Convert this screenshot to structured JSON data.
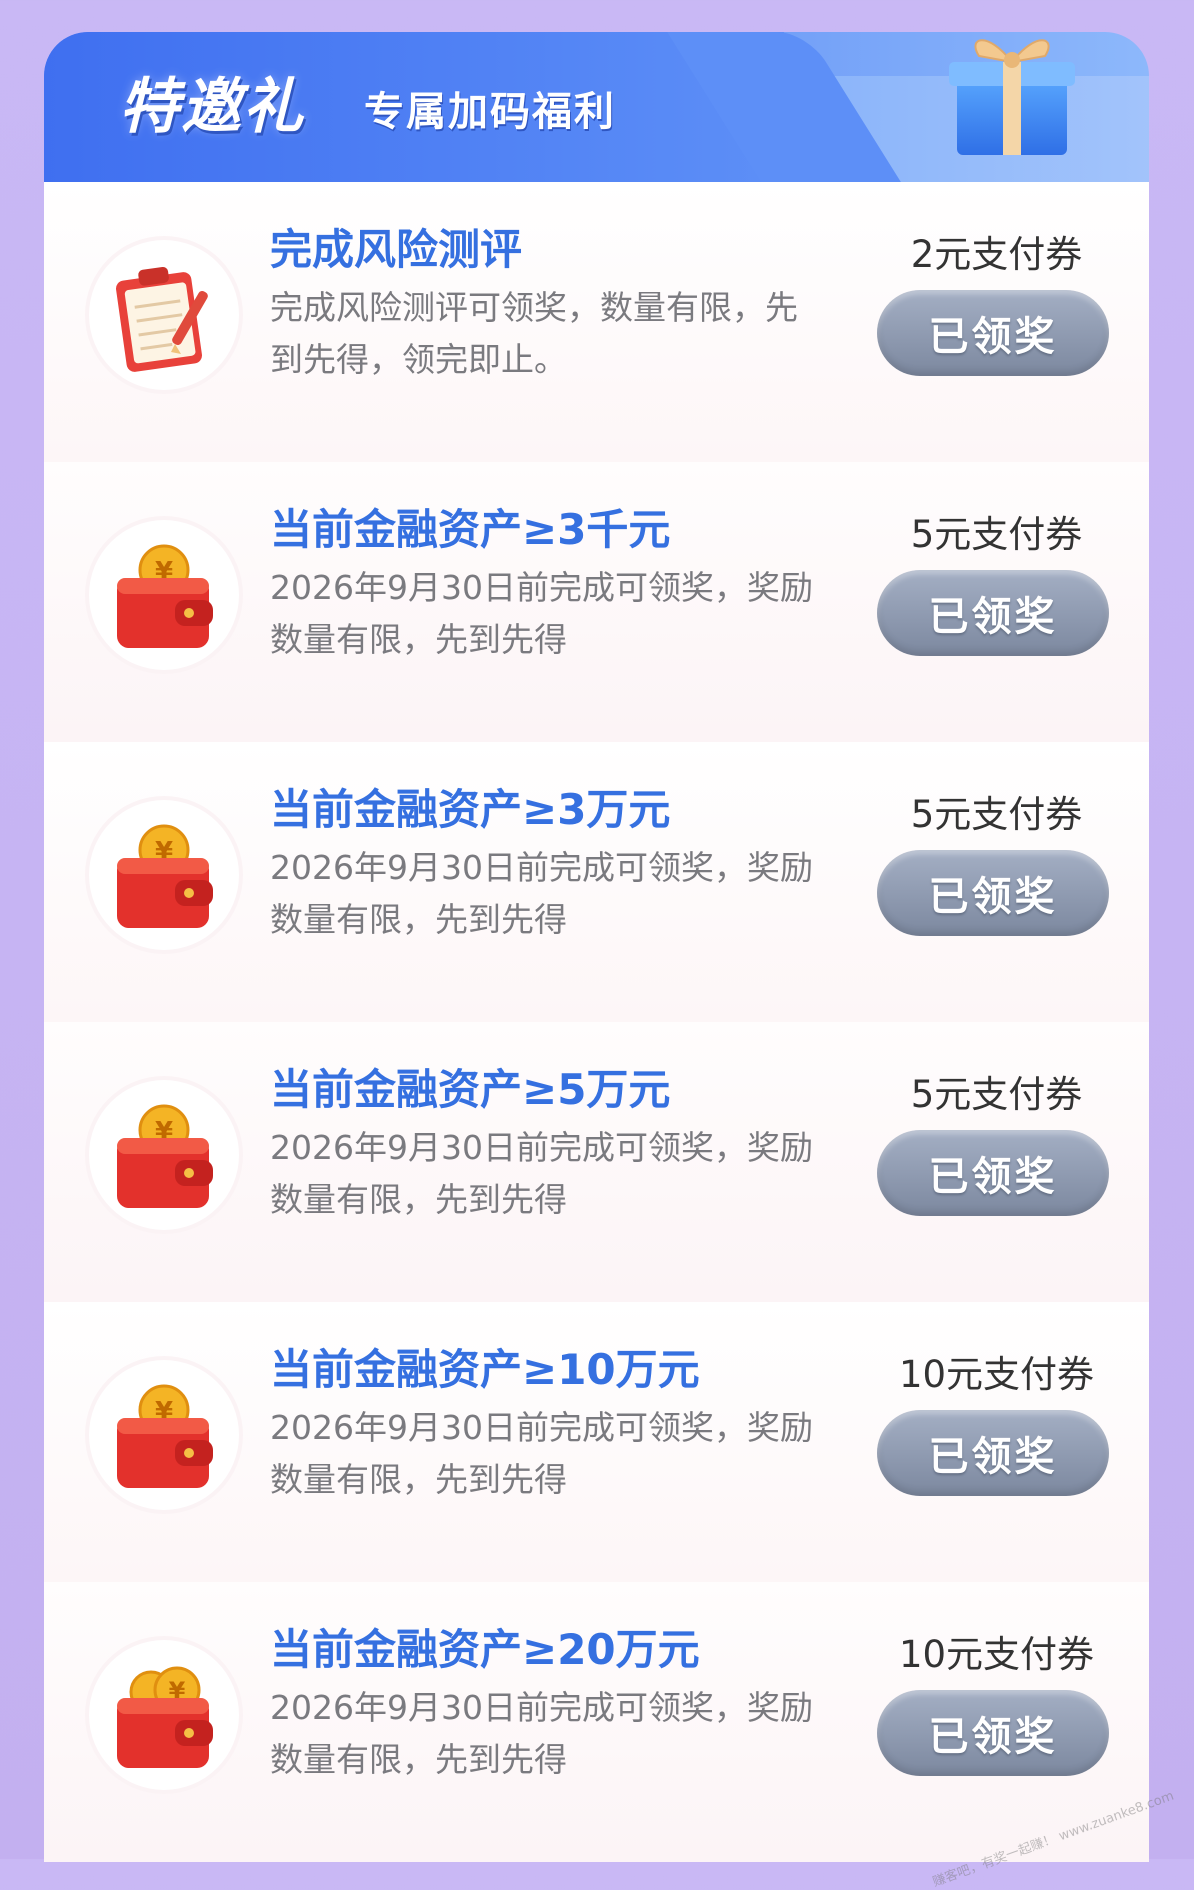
{
  "header": {
    "title": "特邀礼",
    "subtitle": "专属加码福利",
    "decoration": "gift-box-icon"
  },
  "items": [
    {
      "icon": "clipboard-icon",
      "title": "完成风险测评",
      "description": "完成风险测评可领奖，数量有限，先到先得，领完即止。",
      "reward": "2元支付券",
      "button": "已领奖"
    },
    {
      "icon": "wallet-icon",
      "title": "当前金融资产≥3千元",
      "description": "2026年9月30日前完成可领奖，奖励数量有限，先到先得",
      "reward": "5元支付券",
      "button": "已领奖"
    },
    {
      "icon": "wallet-icon",
      "title": "当前金融资产≥3万元",
      "description": "2026年9月30日前完成可领奖，奖励数量有限，先到先得",
      "reward": "5元支付券",
      "button": "已领奖"
    },
    {
      "icon": "wallet-icon",
      "title": "当前金融资产≥5万元",
      "description": "2026年9月30日前完成可领奖，奖励数量有限，先到先得",
      "reward": "5元支付券",
      "button": "已领奖"
    },
    {
      "icon": "wallet-icon",
      "title": "当前金融资产≥10万元",
      "description": "2026年9月30日前完成可领奖，奖励数量有限，先到先得",
      "reward": "10元支付券",
      "button": "已领奖"
    },
    {
      "icon": "wallet-icon",
      "title": "当前金融资产≥20万元",
      "description": "2026年9月30日前完成可领奖，奖励数量有限，先到先得",
      "reward": "10元支付券",
      "button": "已领奖"
    }
  ],
  "watermark": "赚客吧，有奖一起赚！ www.zuanke8.com",
  "colors": {
    "page_bg": "#c6b4f3",
    "header_blue": "#4d7af0",
    "title_blue": "#3570e0",
    "button_gray": "#8e99ae"
  }
}
